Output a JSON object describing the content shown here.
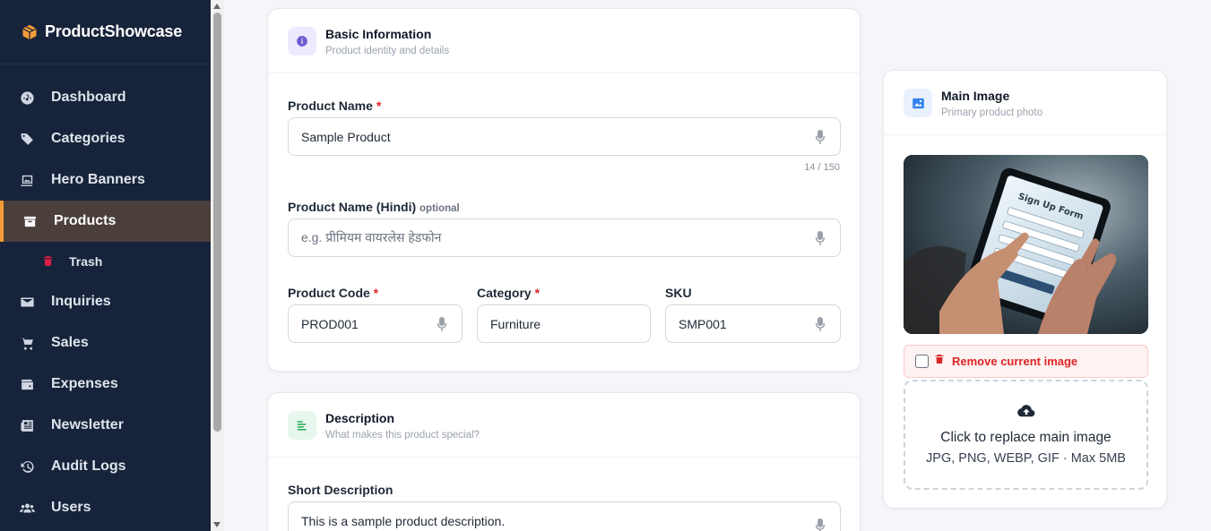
{
  "brand": {
    "name": "ProductShowcase"
  },
  "sidebar": {
    "items": [
      {
        "label": "Dashboard",
        "icon": "gauge-icon"
      },
      {
        "label": "Categories",
        "icon": "tags-icon"
      },
      {
        "label": "Hero Banners",
        "icon": "images-icon"
      },
      {
        "label": "Products",
        "icon": "box-icon",
        "active": true
      },
      {
        "label": "Trash",
        "icon": "trash-icon",
        "sub": true
      },
      {
        "label": "Inquiries",
        "icon": "envelope-icon"
      },
      {
        "label": "Sales",
        "icon": "cart-icon"
      },
      {
        "label": "Expenses",
        "icon": "wallet-icon"
      },
      {
        "label": "Newsletter",
        "icon": "newspaper-icon"
      },
      {
        "label": "Audit Logs",
        "icon": "history-icon"
      },
      {
        "label": "Users",
        "icon": "users-icon"
      }
    ]
  },
  "basic": {
    "title": "Basic Information",
    "subtitle": "Product identity and details",
    "name_label": "Product Name",
    "name_value": "Sample Product",
    "name_counter": "14 / 150",
    "hindi_label": "Product Name (Hindi)",
    "hindi_optional": "optional",
    "hindi_placeholder": "e.g. प्रीमियम वायरलेस हेडफोन",
    "code_label": "Product Code",
    "code_value": "PROD001",
    "category_label": "Category",
    "category_value": "Furniture",
    "sku_label": "SKU",
    "sku_value": "SMP001",
    "required_mark": "*"
  },
  "description": {
    "title": "Description",
    "subtitle": "What makes this product special?",
    "short_label": "Short Description",
    "short_value": "This is a sample product description."
  },
  "main_image": {
    "title": "Main Image",
    "subtitle": "Primary product photo",
    "remove_label": "Remove current image",
    "drop_title": "Click to replace main image",
    "drop_sub": "JPG, PNG, WEBP, GIF · Max 5MB",
    "photo_text": "Sign Up Form"
  },
  "colors": {
    "sidebar_bg": "#17233a",
    "active_accent": "#f29c38",
    "danger": "#dc2626"
  }
}
